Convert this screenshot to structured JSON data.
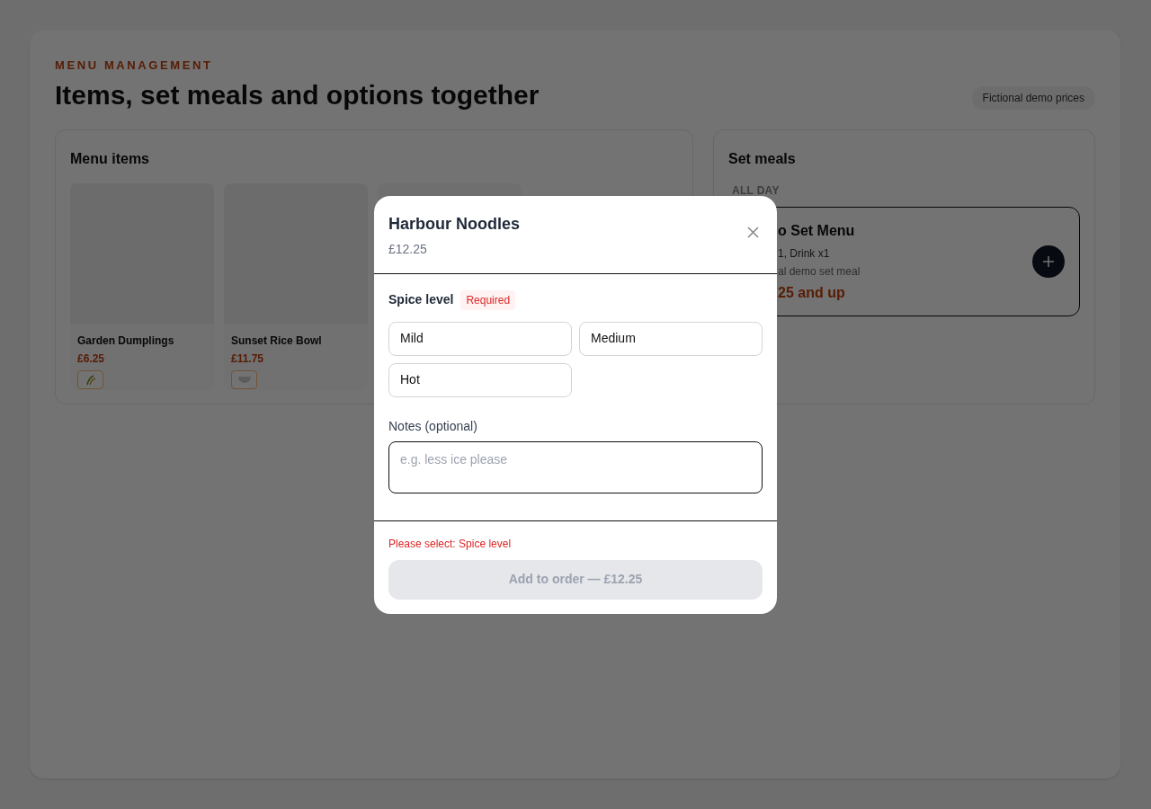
{
  "header": {
    "eyebrow": "MENU MANAGEMENT",
    "title": "Items, set meals and options together",
    "badge": "Fictional demo prices"
  },
  "menu_items": {
    "title": "Menu items",
    "items": [
      {
        "kind": "dish",
        "name": "Garden Dumplings",
        "price": "£6.25"
      },
      {
        "kind": "dish",
        "name": "Sunset Rice Bowl",
        "price": "£11.75"
      },
      {
        "kind": "covered"
      }
    ]
  },
  "set_meals": {
    "title": "Set meals",
    "section": "ALL DAY",
    "card": {
      "name": "o Set Menu",
      "contents": "1, Drink x1",
      "description": "al demo set meal",
      "price": "25 and up"
    }
  },
  "dialog": {
    "title": "Harbour Noodles",
    "price": "£12.25",
    "group": {
      "label": "Spice level",
      "badge": "Required",
      "options": [
        {
          "label": "Mild",
          "selected": false
        },
        {
          "label": "Medium",
          "selected": false
        },
        {
          "label": "Hot",
          "selected": false
        }
      ]
    },
    "notes": {
      "label": "Notes (optional)",
      "placeholder": "e.g. less ice please"
    },
    "error": "Please select: Spice level",
    "submit": {
      "label": "Add to order — £12.25",
      "disabled": true
    }
  }
}
